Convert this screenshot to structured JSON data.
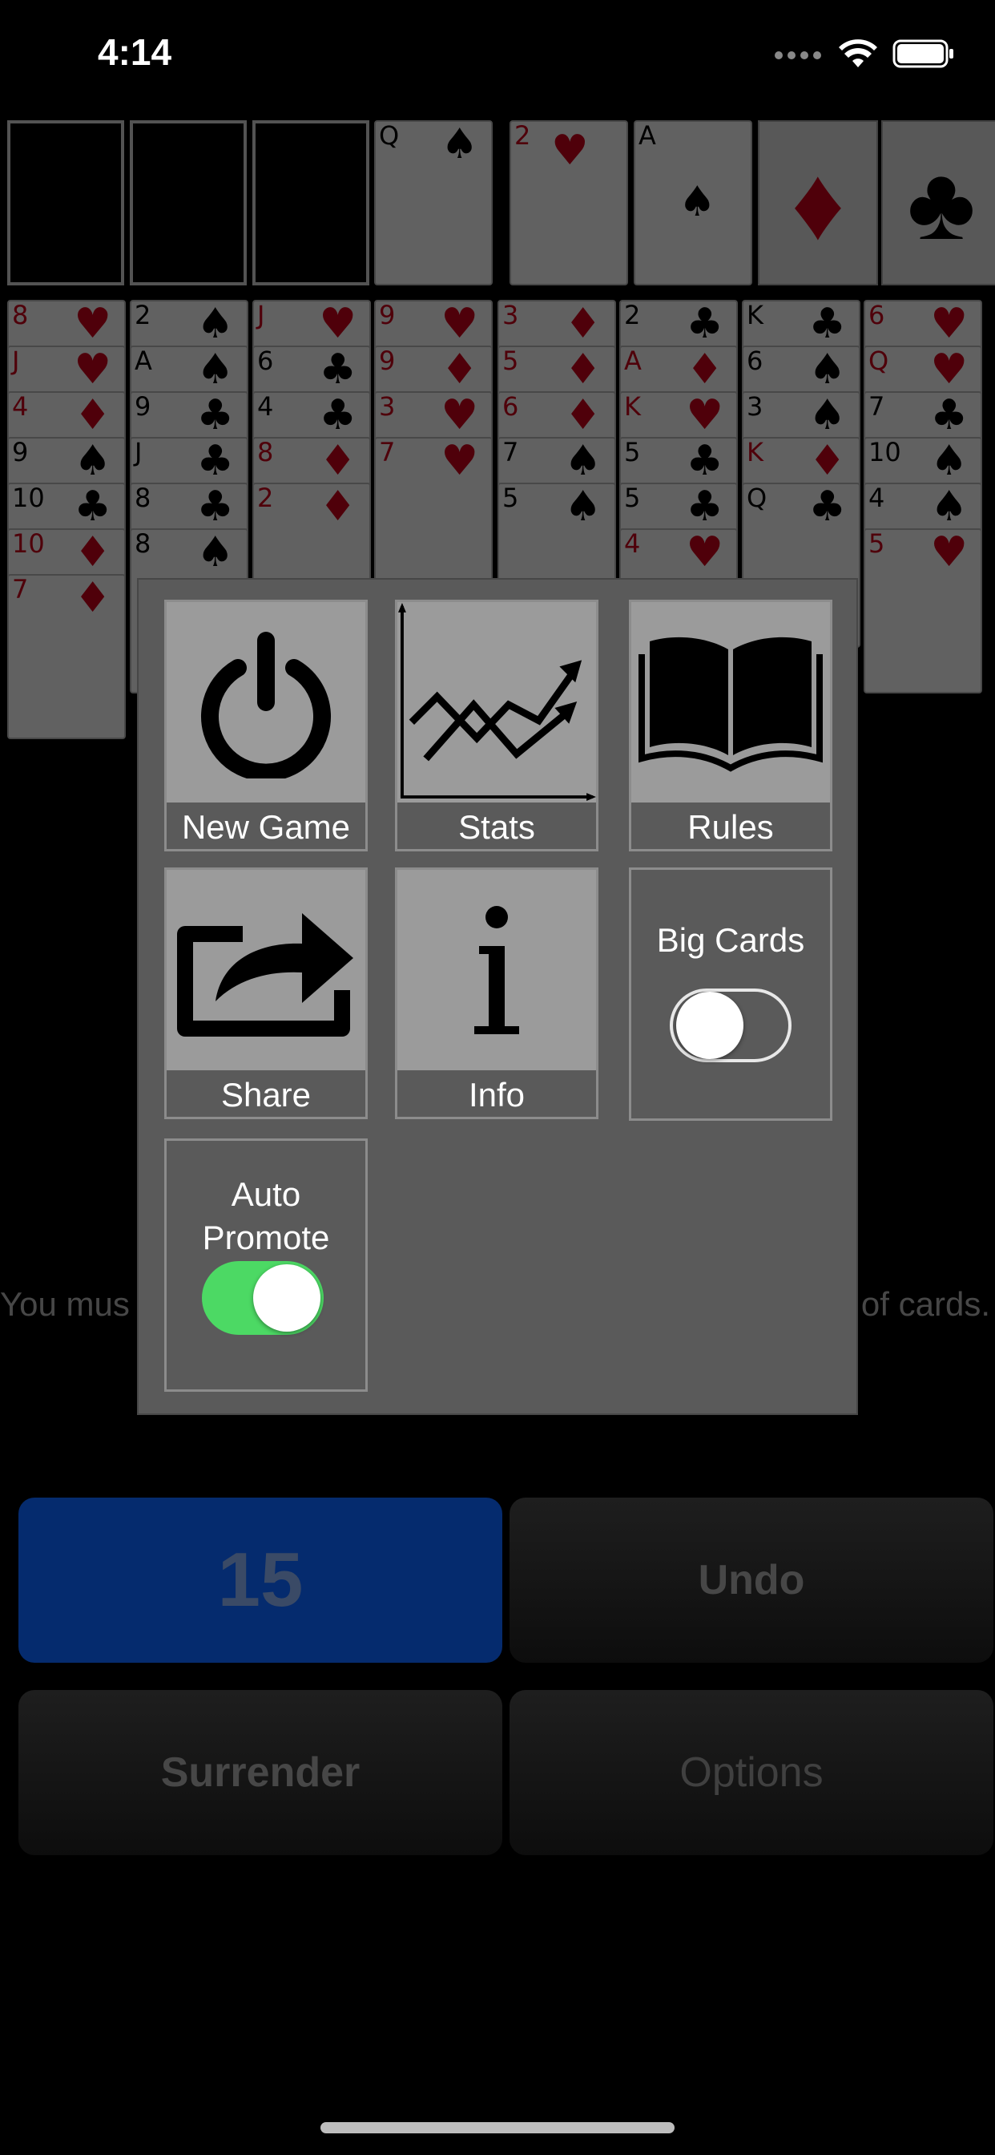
{
  "status_bar": {
    "time": "4:14"
  },
  "board": {
    "top_cards": [
      {
        "rank": "Q",
        "suit": "♠",
        "color": "blk"
      },
      {
        "rank": "2",
        "suit": "♥",
        "color": "red"
      },
      {
        "rank": "A",
        "suit": "♠",
        "color": "blk"
      }
    ],
    "foundation_suits": [
      {
        "suit": "♦",
        "color": "red"
      },
      {
        "suit": "♣",
        "color": "blk"
      }
    ],
    "columns": [
      [
        {
          "r": "8",
          "s": "♥",
          "c": "red"
        },
        {
          "r": "J",
          "s": "♥",
          "c": "red"
        },
        {
          "r": "4",
          "s": "♦",
          "c": "red"
        },
        {
          "r": "9",
          "s": "♠",
          "c": "blk"
        },
        {
          "r": "10",
          "s": "♣",
          "c": "blk"
        },
        {
          "r": "10",
          "s": "♦",
          "c": "red"
        },
        {
          "r": "7",
          "s": "♦",
          "c": "red"
        }
      ],
      [
        {
          "r": "2",
          "s": "♠",
          "c": "blk"
        },
        {
          "r": "A",
          "s": "♠",
          "c": "blk"
        },
        {
          "r": "9",
          "s": "♣",
          "c": "blk"
        },
        {
          "r": "J",
          "s": "♣",
          "c": "blk"
        },
        {
          "r": "8",
          "s": "♣",
          "c": "blk"
        },
        {
          "r": "8",
          "s": "♠",
          "c": "blk"
        }
      ],
      [
        {
          "r": "J",
          "s": "♥",
          "c": "red"
        },
        {
          "r": "6",
          "s": "♣",
          "c": "blk"
        },
        {
          "r": "4",
          "s": "♣",
          "c": "blk"
        },
        {
          "r": "8",
          "s": "♦",
          "c": "red"
        },
        {
          "r": "2",
          "s": "♦",
          "c": "red"
        }
      ],
      [
        {
          "r": "9",
          "s": "♥",
          "c": "red"
        },
        {
          "r": "9",
          "s": "♦",
          "c": "red"
        },
        {
          "r": "3",
          "s": "♥",
          "c": "red"
        },
        {
          "r": "7",
          "s": "♥",
          "c": "red"
        }
      ],
      [
        {
          "r": "3",
          "s": "♦",
          "c": "red"
        },
        {
          "r": "5",
          "s": "♦",
          "c": "red"
        },
        {
          "r": "6",
          "s": "♦",
          "c": "red"
        },
        {
          "r": "7",
          "s": "♠",
          "c": "blk"
        },
        {
          "r": "5",
          "s": "♠",
          "c": "blk"
        }
      ],
      [
        {
          "r": "2",
          "s": "♣",
          "c": "blk"
        },
        {
          "r": "A",
          "s": "♦",
          "c": "red"
        },
        {
          "r": "K",
          "s": "♥",
          "c": "red"
        },
        {
          "r": "5",
          "s": "♣",
          "c": "blk"
        },
        {
          "r": "5",
          "s": "♣",
          "c": "blk"
        },
        {
          "r": "4",
          "s": "♥",
          "c": "red"
        }
      ],
      [
        {
          "r": "K",
          "s": "♣",
          "c": "blk"
        },
        {
          "r": "6",
          "s": "♠",
          "c": "blk"
        },
        {
          "r": "3",
          "s": "♠",
          "c": "blk"
        },
        {
          "r": "K",
          "s": "♦",
          "c": "red"
        },
        {
          "r": "Q",
          "s": "♣",
          "c": "blk"
        }
      ],
      [
        {
          "r": "6",
          "s": "♥",
          "c": "red"
        },
        {
          "r": "Q",
          "s": "♥",
          "c": "red"
        },
        {
          "r": "7",
          "s": "♣",
          "c": "blk"
        },
        {
          "r": "10",
          "s": "♠",
          "c": "blk"
        },
        {
          "r": "4",
          "s": "♠",
          "c": "blk"
        },
        {
          "r": "5",
          "s": "♥",
          "c": "red"
        }
      ]
    ],
    "hint_left": "You mus",
    "hint_right": "of cards."
  },
  "buttons": {
    "moves": "15",
    "undo": "Undo",
    "surrender": "Surrender",
    "options": "Options"
  },
  "menu": {
    "new_game": "New Game",
    "stats": "Stats",
    "rules": "Rules",
    "share": "Share",
    "info": "Info",
    "big_cards": {
      "label": "Big Cards",
      "on": false
    },
    "auto_promote": {
      "label_line1": "Auto",
      "label_line2": "Promote",
      "on": true
    }
  },
  "colors": {
    "accent_green": "#4cd964",
    "moves_blue": "#052b6e"
  }
}
